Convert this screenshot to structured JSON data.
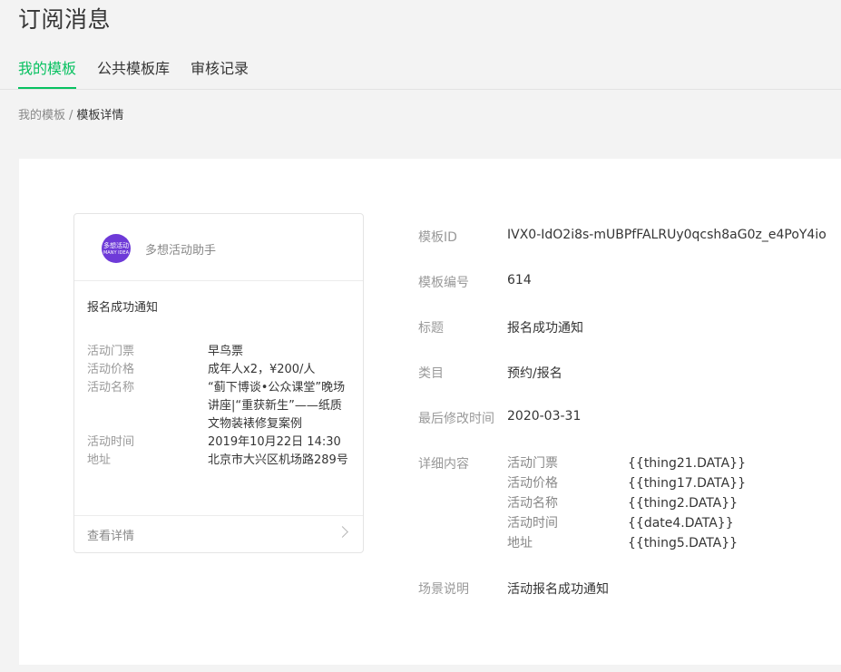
{
  "header": {
    "title": "订阅消息",
    "tabs": [
      {
        "label": "我的模板",
        "active": true
      },
      {
        "label": "公共模板库",
        "active": false
      },
      {
        "label": "审核记录",
        "active": false
      }
    ]
  },
  "breadcrumb": {
    "parent": "我的模板",
    "separator": "/",
    "current": "模板详情"
  },
  "preview_card": {
    "avatar_text_line1": "多想活动",
    "avatar_text_line2": "MANY IDEA",
    "app_name": "多想活动助手",
    "message_title": "报名成功通知",
    "rows": [
      {
        "key": "活动门票",
        "value": "早鸟票"
      },
      {
        "key": "活动价格",
        "value": "成年人x2，¥200/人"
      },
      {
        "key": "活动名称",
        "value": "“蓟下博谈•公众课堂”晚场讲座|“重获新生”——纸质文物装裱修复案例"
      },
      {
        "key": "活动时间",
        "value": "2019年10月22日 14:30"
      },
      {
        "key": "地址",
        "value": "北京市大兴区机场路289号"
      }
    ],
    "footer_label": "查看详情",
    "footer_icon": "chevron-right-icon"
  },
  "details": {
    "template_id_label": "模板ID",
    "template_id": "IVX0-IdO2i8s-mUBPfFALRUy0qcsh8aG0z_e4PoY4io",
    "template_no_label": "模板编号",
    "template_no": "614",
    "title_label": "标题",
    "title": "报名成功通知",
    "category_label": "类目",
    "category": "预约/报名",
    "modified_label": "最后修改时间",
    "modified": "2020-03-31",
    "content_label": "详细内容",
    "content": [
      {
        "key": "活动门票",
        "value": "{{thing21.DATA}}"
      },
      {
        "key": "活动价格",
        "value": "{{thing17.DATA}}"
      },
      {
        "key": "活动名称",
        "value": "{{thing2.DATA}}"
      },
      {
        "key": "活动时间",
        "value": "{{date4.DATA}}"
      },
      {
        "key": "地址",
        "value": "{{thing5.DATA}}"
      }
    ],
    "scene_label": "场景说明",
    "scene": "活动报名成功通知"
  },
  "colors": {
    "accent": "#07c160",
    "avatar": "#6e3ad8",
    "background": "#f3f3f3"
  }
}
